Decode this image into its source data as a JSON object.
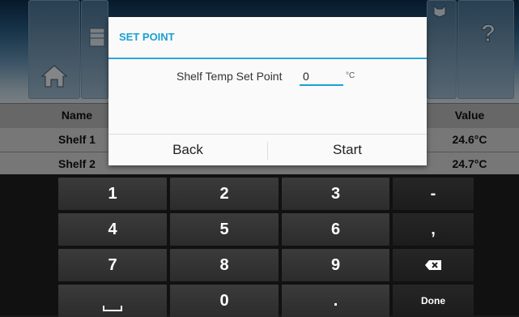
{
  "nav": {
    "icons": [
      "home-icon",
      "table-icon",
      "user-icon",
      "chart-icon",
      "settings-icon",
      "cat-icon",
      "help-icon"
    ]
  },
  "table": {
    "headers": {
      "name": "Name",
      "value": "Value"
    },
    "rows": [
      {
        "name": "Shelf 1",
        "value": "24.6°C"
      },
      {
        "name": "Shelf 2",
        "value": "24.7°C"
      }
    ]
  },
  "dialog": {
    "title": "SET POINT",
    "label": "Shelf Temp Set Point",
    "value": "0",
    "unit": "°C",
    "back": "Back",
    "start": "Start"
  },
  "keyboard": {
    "keys": [
      [
        "1",
        "2",
        "3",
        "-"
      ],
      [
        "4",
        "5",
        "6",
        ","
      ],
      [
        "7",
        "8",
        "9",
        "backspace"
      ],
      [
        "space",
        "0",
        ".",
        "Done"
      ]
    ],
    "minus": "-",
    "comma": ",",
    "dot": ".",
    "done": "Done"
  }
}
